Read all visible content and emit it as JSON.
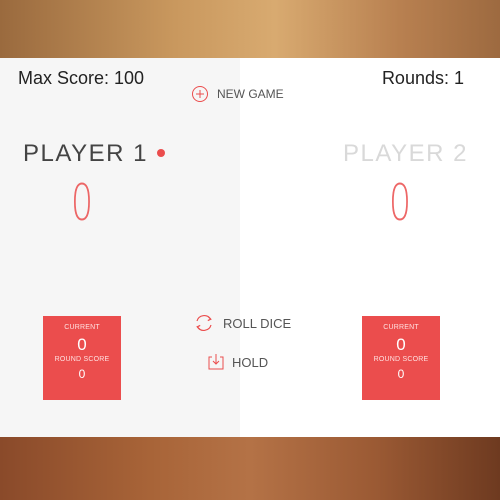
{
  "header": {
    "max_score": "Max Score: 100",
    "rounds": "Rounds: 1"
  },
  "buttons": {
    "new_game": "NEW GAME",
    "roll_dice": "ROLL DICE",
    "hold": "HOLD"
  },
  "player1": {
    "name": "PLAYER 1",
    "score": "0",
    "active": true,
    "current_label": "CURRENT",
    "current_value": "0",
    "round_label": "ROUND SCORE",
    "round_value": "0"
  },
  "player2": {
    "name": "PLAYER 2",
    "score": "0",
    "active": false,
    "current_label": "CURRENT",
    "current_value": "0",
    "round_label": "ROUND SCORE",
    "round_value": "0"
  },
  "colors": {
    "accent": "#eb4d4d",
    "inactive_name": "#d9d9d9",
    "active_name": "#444444"
  },
  "icons": {
    "new_game": "plus-circle-icon",
    "roll_dice": "refresh-icon",
    "hold": "download-tray-icon",
    "active_indicator": "dot-icon"
  }
}
